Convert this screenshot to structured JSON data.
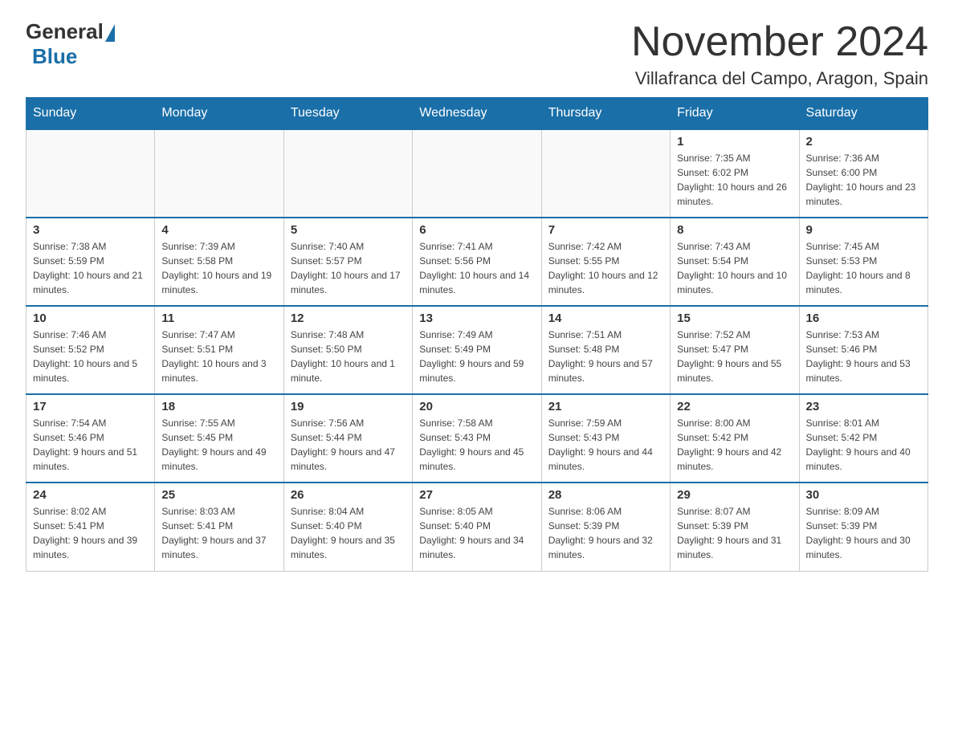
{
  "logo": {
    "general": "General",
    "blue": "Blue"
  },
  "title": "November 2024",
  "subtitle": "Villafranca del Campo, Aragon, Spain",
  "days_of_week": [
    "Sunday",
    "Monday",
    "Tuesday",
    "Wednesday",
    "Thursday",
    "Friday",
    "Saturday"
  ],
  "weeks": [
    [
      {
        "day": "",
        "info": ""
      },
      {
        "day": "",
        "info": ""
      },
      {
        "day": "",
        "info": ""
      },
      {
        "day": "",
        "info": ""
      },
      {
        "day": "",
        "info": ""
      },
      {
        "day": "1",
        "info": "Sunrise: 7:35 AM\nSunset: 6:02 PM\nDaylight: 10 hours and 26 minutes."
      },
      {
        "day": "2",
        "info": "Sunrise: 7:36 AM\nSunset: 6:00 PM\nDaylight: 10 hours and 23 minutes."
      }
    ],
    [
      {
        "day": "3",
        "info": "Sunrise: 7:38 AM\nSunset: 5:59 PM\nDaylight: 10 hours and 21 minutes."
      },
      {
        "day": "4",
        "info": "Sunrise: 7:39 AM\nSunset: 5:58 PM\nDaylight: 10 hours and 19 minutes."
      },
      {
        "day": "5",
        "info": "Sunrise: 7:40 AM\nSunset: 5:57 PM\nDaylight: 10 hours and 17 minutes."
      },
      {
        "day": "6",
        "info": "Sunrise: 7:41 AM\nSunset: 5:56 PM\nDaylight: 10 hours and 14 minutes."
      },
      {
        "day": "7",
        "info": "Sunrise: 7:42 AM\nSunset: 5:55 PM\nDaylight: 10 hours and 12 minutes."
      },
      {
        "day": "8",
        "info": "Sunrise: 7:43 AM\nSunset: 5:54 PM\nDaylight: 10 hours and 10 minutes."
      },
      {
        "day": "9",
        "info": "Sunrise: 7:45 AM\nSunset: 5:53 PM\nDaylight: 10 hours and 8 minutes."
      }
    ],
    [
      {
        "day": "10",
        "info": "Sunrise: 7:46 AM\nSunset: 5:52 PM\nDaylight: 10 hours and 5 minutes."
      },
      {
        "day": "11",
        "info": "Sunrise: 7:47 AM\nSunset: 5:51 PM\nDaylight: 10 hours and 3 minutes."
      },
      {
        "day": "12",
        "info": "Sunrise: 7:48 AM\nSunset: 5:50 PM\nDaylight: 10 hours and 1 minute."
      },
      {
        "day": "13",
        "info": "Sunrise: 7:49 AM\nSunset: 5:49 PM\nDaylight: 9 hours and 59 minutes."
      },
      {
        "day": "14",
        "info": "Sunrise: 7:51 AM\nSunset: 5:48 PM\nDaylight: 9 hours and 57 minutes."
      },
      {
        "day": "15",
        "info": "Sunrise: 7:52 AM\nSunset: 5:47 PM\nDaylight: 9 hours and 55 minutes."
      },
      {
        "day": "16",
        "info": "Sunrise: 7:53 AM\nSunset: 5:46 PM\nDaylight: 9 hours and 53 minutes."
      }
    ],
    [
      {
        "day": "17",
        "info": "Sunrise: 7:54 AM\nSunset: 5:46 PM\nDaylight: 9 hours and 51 minutes."
      },
      {
        "day": "18",
        "info": "Sunrise: 7:55 AM\nSunset: 5:45 PM\nDaylight: 9 hours and 49 minutes."
      },
      {
        "day": "19",
        "info": "Sunrise: 7:56 AM\nSunset: 5:44 PM\nDaylight: 9 hours and 47 minutes."
      },
      {
        "day": "20",
        "info": "Sunrise: 7:58 AM\nSunset: 5:43 PM\nDaylight: 9 hours and 45 minutes."
      },
      {
        "day": "21",
        "info": "Sunrise: 7:59 AM\nSunset: 5:43 PM\nDaylight: 9 hours and 44 minutes."
      },
      {
        "day": "22",
        "info": "Sunrise: 8:00 AM\nSunset: 5:42 PM\nDaylight: 9 hours and 42 minutes."
      },
      {
        "day": "23",
        "info": "Sunrise: 8:01 AM\nSunset: 5:42 PM\nDaylight: 9 hours and 40 minutes."
      }
    ],
    [
      {
        "day": "24",
        "info": "Sunrise: 8:02 AM\nSunset: 5:41 PM\nDaylight: 9 hours and 39 minutes."
      },
      {
        "day": "25",
        "info": "Sunrise: 8:03 AM\nSunset: 5:41 PM\nDaylight: 9 hours and 37 minutes."
      },
      {
        "day": "26",
        "info": "Sunrise: 8:04 AM\nSunset: 5:40 PM\nDaylight: 9 hours and 35 minutes."
      },
      {
        "day": "27",
        "info": "Sunrise: 8:05 AM\nSunset: 5:40 PM\nDaylight: 9 hours and 34 minutes."
      },
      {
        "day": "28",
        "info": "Sunrise: 8:06 AM\nSunset: 5:39 PM\nDaylight: 9 hours and 32 minutes."
      },
      {
        "day": "29",
        "info": "Sunrise: 8:07 AM\nSunset: 5:39 PM\nDaylight: 9 hours and 31 minutes."
      },
      {
        "day": "30",
        "info": "Sunrise: 8:09 AM\nSunset: 5:39 PM\nDaylight: 9 hours and 30 minutes."
      }
    ]
  ]
}
